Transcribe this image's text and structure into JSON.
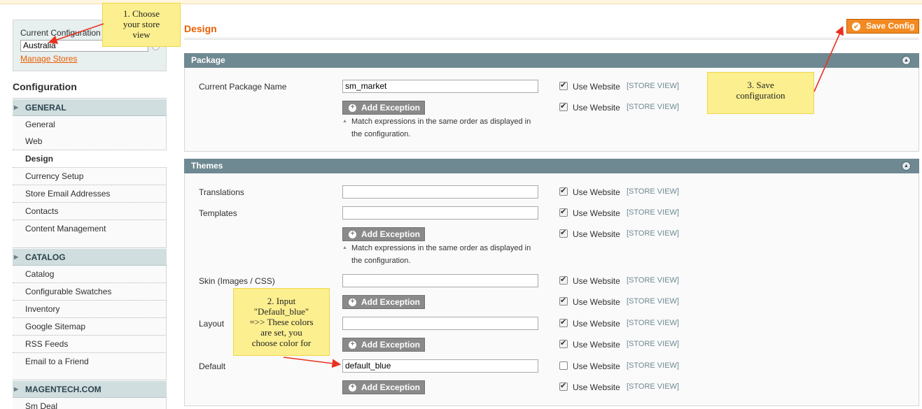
{
  "sidebar": {
    "current_config_label": "Current Configuration Scope:",
    "current_store": "Australia",
    "manage_stores": "Manage Stores",
    "title": "Configuration",
    "sections": [
      {
        "label": "GENERAL",
        "items": [
          "General",
          "Web",
          "Design",
          "Currency Setup",
          "Store Email Addresses",
          "Contacts",
          "Content Management"
        ]
      },
      {
        "label": "CATALOG",
        "items": [
          "Catalog",
          "Configurable Swatches",
          "Inventory",
          "Google Sitemap",
          "RSS Feeds",
          "Email to a Friend"
        ]
      },
      {
        "label": "MAGENTECH.COM",
        "items": [
          "Sm Deal"
        ]
      }
    ],
    "active_item": "Design"
  },
  "main": {
    "page_title": "Design",
    "save_button": "Save Config",
    "common": {
      "use_website": "Use Website",
      "store_view": "[STORE VIEW]",
      "add_exception": "Add Exception",
      "note_line1": "Match expressions in the same order as displayed in",
      "note_line2": "the configuration."
    },
    "package": {
      "title": "Package",
      "current_package_label": "Current Package Name",
      "current_package_value": "sm_market"
    },
    "themes": {
      "title": "Themes",
      "translations_label": "Translations",
      "translations_value": "",
      "templates_label": "Templates",
      "templates_value": "",
      "skin_label": "Skin (Images / CSS)",
      "skin_value": "",
      "layout_label": "Layout",
      "layout_value": "",
      "default_label": "Default",
      "default_value": "default_blue"
    }
  },
  "callouts": {
    "step1": [
      "1. Choose",
      "your store",
      "view"
    ],
    "step2": [
      "2. Input",
      "\"Default_blue\"",
      "=>> These colors",
      "are set, you",
      "choose color for"
    ],
    "step3": [
      "3. Save",
      "configuration"
    ]
  },
  "colors": {
    "accent": "#eb5e00",
    "save_button": "#f38a21",
    "fieldset_header": "#6f8992",
    "section_header": "#d1dedf",
    "callout": "#fcef8f"
  }
}
